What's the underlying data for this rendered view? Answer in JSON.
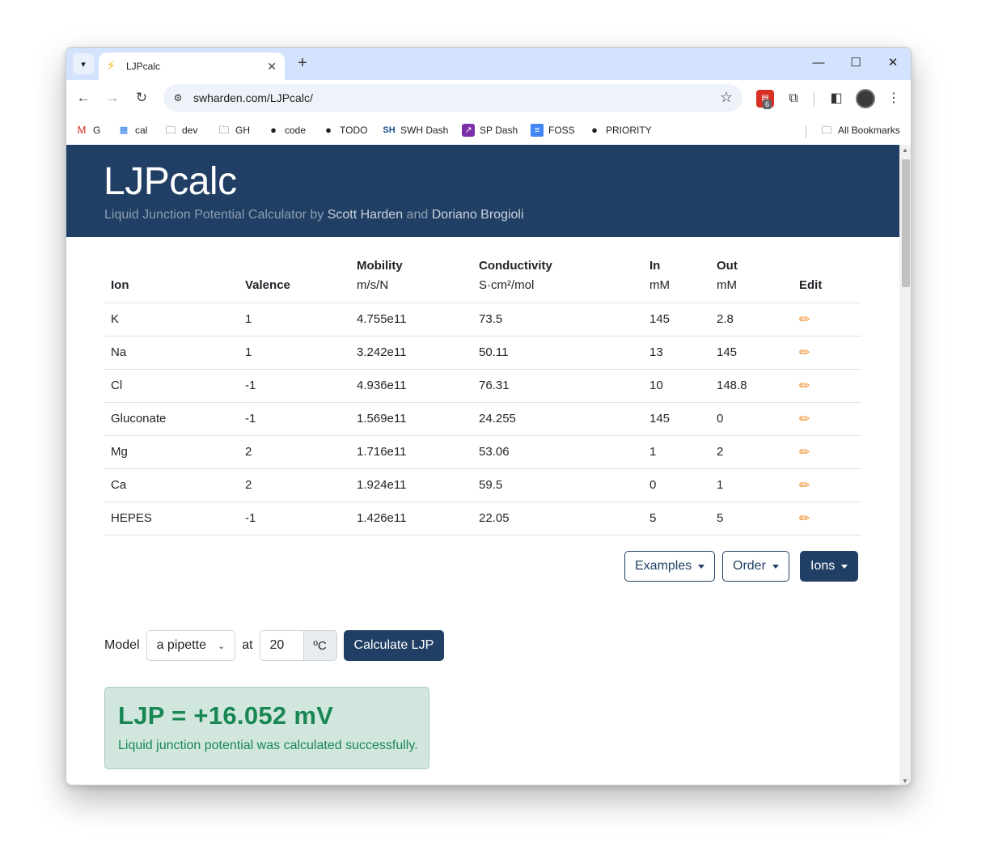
{
  "browser": {
    "tab_title": "LJPcalc",
    "url": "swharden.com/LJPcalc/",
    "extension_badge": "6",
    "bookmarks": [
      {
        "label": "G",
        "icon": "gmail-icon"
      },
      {
        "label": "cal",
        "icon": "calendar-icon"
      },
      {
        "label": "dev",
        "icon": "folder-icon"
      },
      {
        "label": "GH",
        "icon": "folder-icon"
      },
      {
        "label": "code",
        "icon": "github-icon"
      },
      {
        "label": "TODO",
        "icon": "github-icon"
      },
      {
        "label": "SWH Dash",
        "icon": "swh-icon"
      },
      {
        "label": "SP Dash",
        "icon": "chart-icon"
      },
      {
        "label": "FOSS",
        "icon": "doc-icon"
      },
      {
        "label": "PRIORITY",
        "icon": "github-icon"
      }
    ],
    "all_bookmarks": "All Bookmarks"
  },
  "hero": {
    "title": "LJPcalc",
    "subtitle_prefix": "Liquid Junction Potential Calculator by ",
    "author1": "Scott Harden",
    "and": " and ",
    "author2": "Doriano Brogioli"
  },
  "table": {
    "headers": [
      {
        "name": "Ion",
        "unit": ""
      },
      {
        "name": "Valence",
        "unit": ""
      },
      {
        "name": "Mobility",
        "unit": "m/s/N"
      },
      {
        "name": "Conductivity",
        "unit": "S·cm²/mol"
      },
      {
        "name": "In",
        "unit": "mM"
      },
      {
        "name": "Out",
        "unit": "mM"
      },
      {
        "name": "Edit",
        "unit": ""
      }
    ],
    "rows": [
      {
        "ion": "K",
        "valence": "1",
        "mobility": "4.755e11",
        "conductivity": "73.5",
        "in": "145",
        "out": "2.8"
      },
      {
        "ion": "Na",
        "valence": "1",
        "mobility": "3.242e11",
        "conductivity": "50.11",
        "in": "13",
        "out": "145"
      },
      {
        "ion": "Cl",
        "valence": "-1",
        "mobility": "4.936e11",
        "conductivity": "76.31",
        "in": "10",
        "out": "148.8"
      },
      {
        "ion": "Gluconate",
        "valence": "-1",
        "mobility": "1.569e11",
        "conductivity": "24.255",
        "in": "145",
        "out": "0"
      },
      {
        "ion": "Mg",
        "valence": "2",
        "mobility": "1.716e11",
        "conductivity": "53.06",
        "in": "1",
        "out": "2"
      },
      {
        "ion": "Ca",
        "valence": "2",
        "mobility": "1.924e11",
        "conductivity": "59.5",
        "in": "0",
        "out": "1"
      },
      {
        "ion": "HEPES",
        "valence": "-1",
        "mobility": "1.426e11",
        "conductivity": "22.05",
        "in": "5",
        "out": "5"
      }
    ]
  },
  "buttons": {
    "examples": "Examples",
    "order": "Order",
    "ions": "Ions"
  },
  "model": {
    "label": "Model",
    "selected": "a pipette",
    "at": "at",
    "temperature": "20",
    "unit": "ºC",
    "calculate": "Calculate LJP"
  },
  "result": {
    "ljp": "LJP = +16.052 mV",
    "message": "Liquid junction potential was calculated successfully."
  },
  "colors": {
    "brand": "#213f64",
    "success_bg": "#d1e7dd",
    "success_text": "#198754",
    "edit_icon": "#f08a24"
  }
}
